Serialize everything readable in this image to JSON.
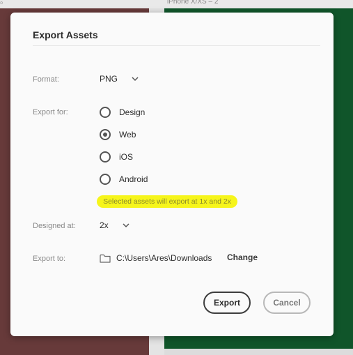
{
  "canvas": {
    "artboard_label": "iPhone X/XS – 2",
    "corner_mark": "₀"
  },
  "dialog": {
    "title": "Export Assets",
    "format": {
      "label": "Format:",
      "value": "PNG"
    },
    "export_for": {
      "label": "Export for:",
      "options": [
        "Design",
        "Web",
        "iOS",
        "Android"
      ],
      "selected": "Web"
    },
    "hint": "Selected assets will export at 1x and 2x",
    "designed_at": {
      "label": "Designed at:",
      "value": "2x"
    },
    "export_to": {
      "label": "Export to:",
      "path": "C:\\Users\\Ares\\Downloads",
      "change_label": "Change"
    },
    "buttons": {
      "export": "Export",
      "cancel": "Cancel"
    }
  },
  "colors": {
    "left_artboard": "#673a3a",
    "right_artboard": "#10552a",
    "highlight": "#f6f51b"
  }
}
